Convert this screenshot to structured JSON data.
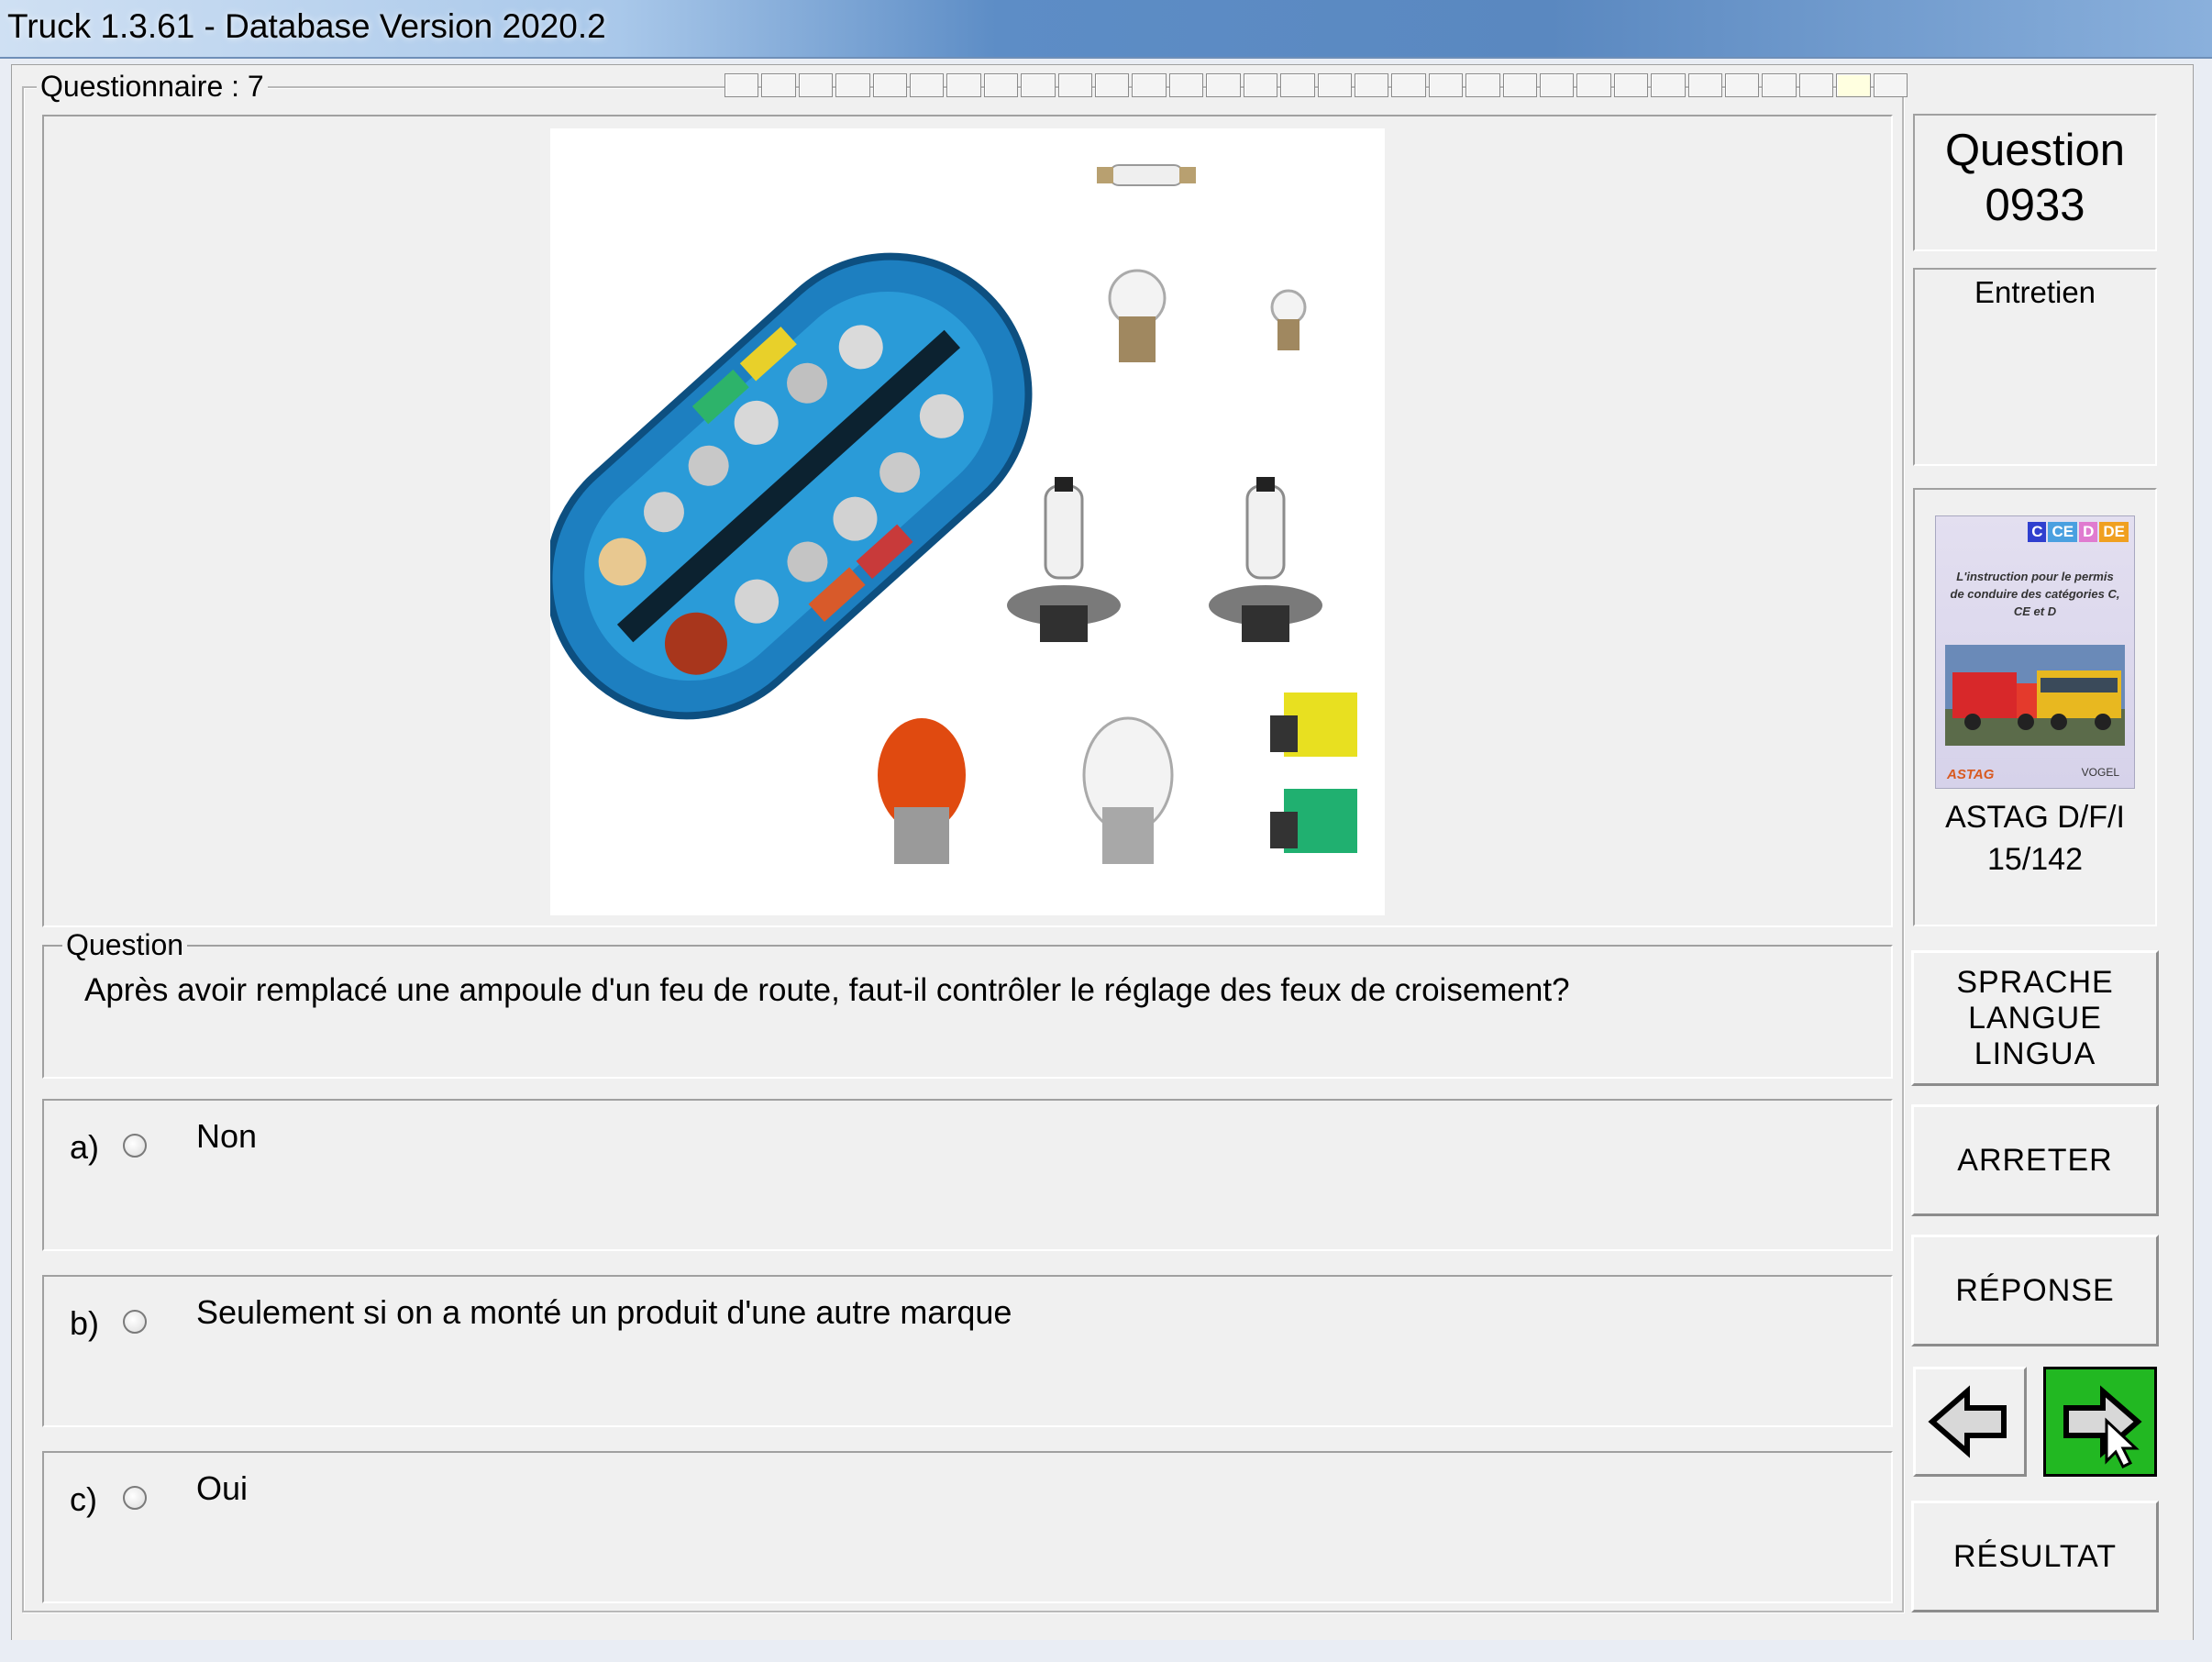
{
  "window": {
    "title": "Truck 1.3.61 - Database Version 2020.2"
  },
  "questionnaire": {
    "label": "Questionnaire : 7",
    "progress_total": 32,
    "progress_current": 31
  },
  "question_panel": {
    "legend": "Question",
    "text": "Après avoir remplacé une ampoule d'un feu de route, faut-il contrôler le réglage des feux de croisement?"
  },
  "answers": [
    {
      "letter": "a)",
      "text": "Non",
      "selected": false
    },
    {
      "letter": "b)",
      "text": "Seulement si on a monté un produit d'une autre marque",
      "selected": false
    },
    {
      "letter": "c)",
      "text": "Oui",
      "selected": false
    }
  ],
  "sidebar": {
    "question_heading": "Question",
    "question_number": "0933",
    "category": "Entretien",
    "book": {
      "badges": [
        "C",
        "CE",
        "D",
        "DE"
      ],
      "cover_text": "L'instruction pour le permis de conduire des catégories C, CE et D",
      "publisher_left": "ASTAG",
      "publisher_right": "VOGEL",
      "title": "ASTAG D/F/I",
      "page": "15/142"
    },
    "buttons": {
      "language_line1": "SPRACHE",
      "language_line2": "LANGUE",
      "language_line3": "LINGUA",
      "stop": "ARRETER",
      "answer": "RÉPONSE",
      "result": "RÉSULTAT"
    }
  },
  "colors": {
    "next_button_bg": "#22b822",
    "window_bg": "#f0f0f0",
    "badge_colors": [
      "#2f3fcf",
      "#4aa0e0",
      "#e07bd0",
      "#f0a020"
    ]
  },
  "icons": {
    "prev": "left-arrow-icon",
    "next": "right-arrow-icon"
  }
}
